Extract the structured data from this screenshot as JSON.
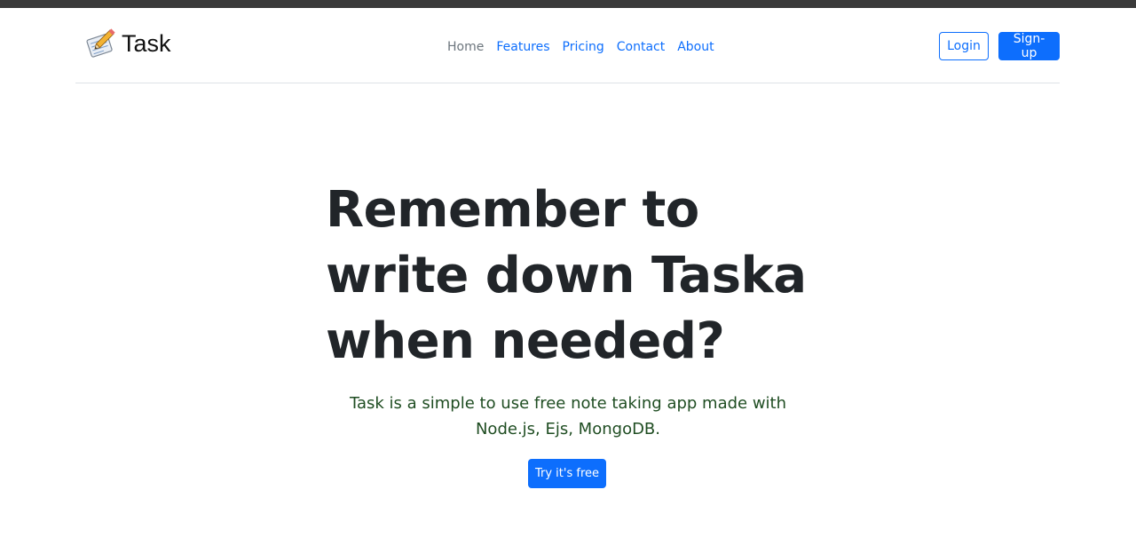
{
  "brand": {
    "name": "Task",
    "icon": "memo-pencil-icon"
  },
  "nav": {
    "items": [
      {
        "label": "Home"
      },
      {
        "label": "Features"
      },
      {
        "label": "Pricing"
      },
      {
        "label": "Contact"
      },
      {
        "label": "About"
      }
    ]
  },
  "actions": {
    "login_label": "Login",
    "signup_label": "Sign-up"
  },
  "hero": {
    "title": "Remember to write down Taska when needed?",
    "subtitle": "Task is a simple to use free note taking app made with Node.js, Ejs, MongoDB.",
    "cta_label": "Try it's free"
  },
  "colors": {
    "accent": "#0d6efd",
    "title": "#212529",
    "subtitle": "#1f4d22",
    "nav_active": "#6c757d",
    "topbar": "#3a3a3a"
  }
}
